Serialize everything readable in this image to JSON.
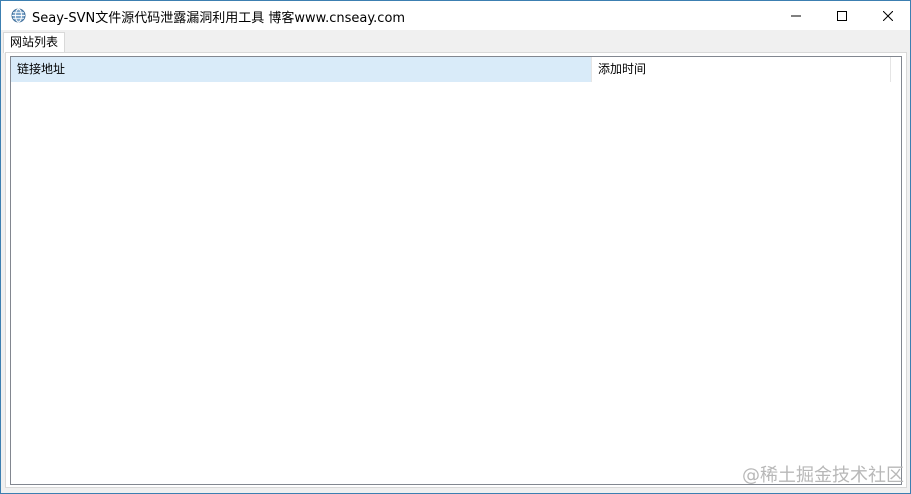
{
  "window": {
    "title": "Seay-SVN文件源代码泄露漏洞利用工具  博客www.cnseay.com",
    "icon": "app-globe-icon",
    "controls": {
      "minimize": "minimize-icon",
      "maximize": "maximize-icon",
      "close": "close-icon"
    }
  },
  "tabs": [
    {
      "label": "网站列表",
      "selected": true
    }
  ],
  "list": {
    "columns": [
      {
        "label": "链接地址"
      },
      {
        "label": "添加时间"
      }
    ],
    "rows": []
  },
  "watermark": "@稀土掘金技术社区",
  "colors": {
    "window_border": "#3c7fb1",
    "header_highlight": "#d9ebf9",
    "chrome_background": "#f0f0f0"
  }
}
